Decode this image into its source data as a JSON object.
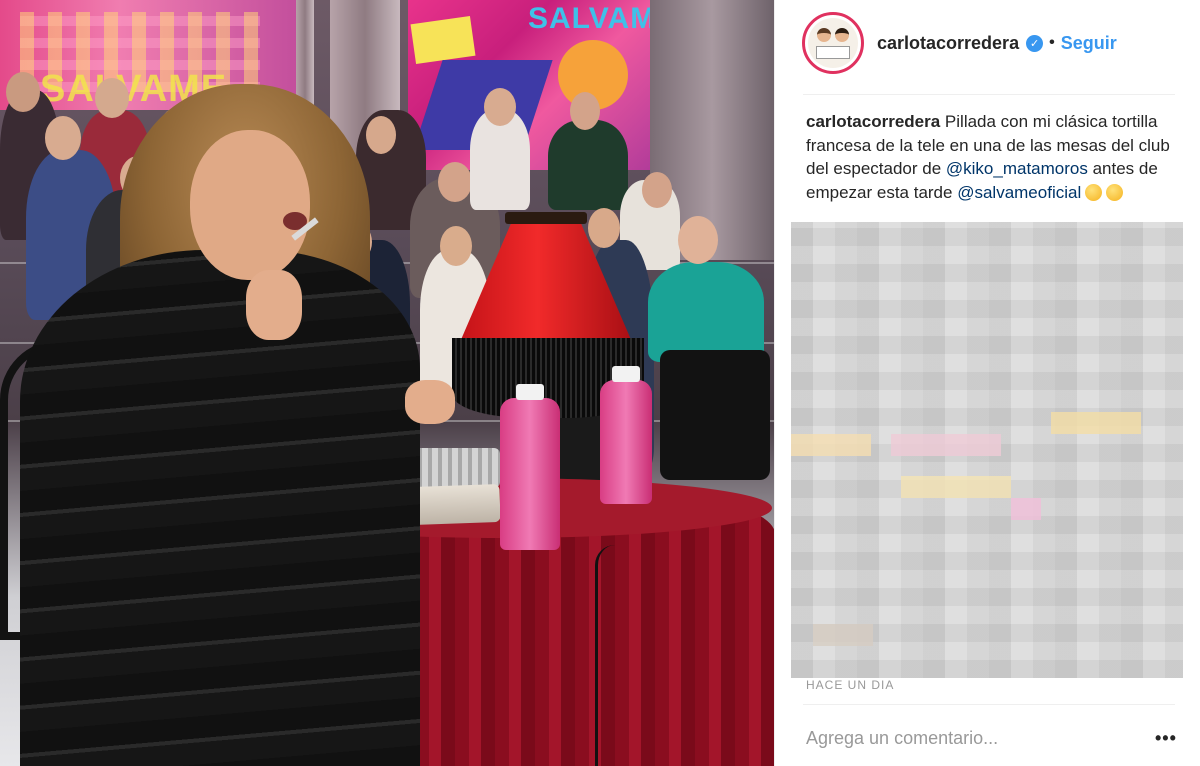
{
  "photo": {
    "background_logo_left": "SALVAME",
    "background_logo_right": "SALVAM"
  },
  "post": {
    "username": "carlotacorredera",
    "verified_icon": "verified-badge-icon",
    "separator": "•",
    "follow_label": "Seguir",
    "caption": {
      "user": "carlotacorredera",
      "text_1": "Pillada con mi clásica tortilla francesa de la tele en una de las mesas del club del espectador de",
      "mention_1": "@kiko_matamoros",
      "text_2": "antes de empezar esta tarde",
      "mention_2": "@salvameoficial",
      "emojis": [
        "surprised-face-icon",
        "yum-face-icon"
      ]
    },
    "timestamp": "HACE UN DIA",
    "comment_placeholder": "Agrega un comentario...",
    "more_label": "•••"
  },
  "colors": {
    "accent": "#3897f0",
    "avatar_ring": "#e0315f",
    "text": "#262626",
    "muted": "#999999",
    "mention": "#003569"
  }
}
